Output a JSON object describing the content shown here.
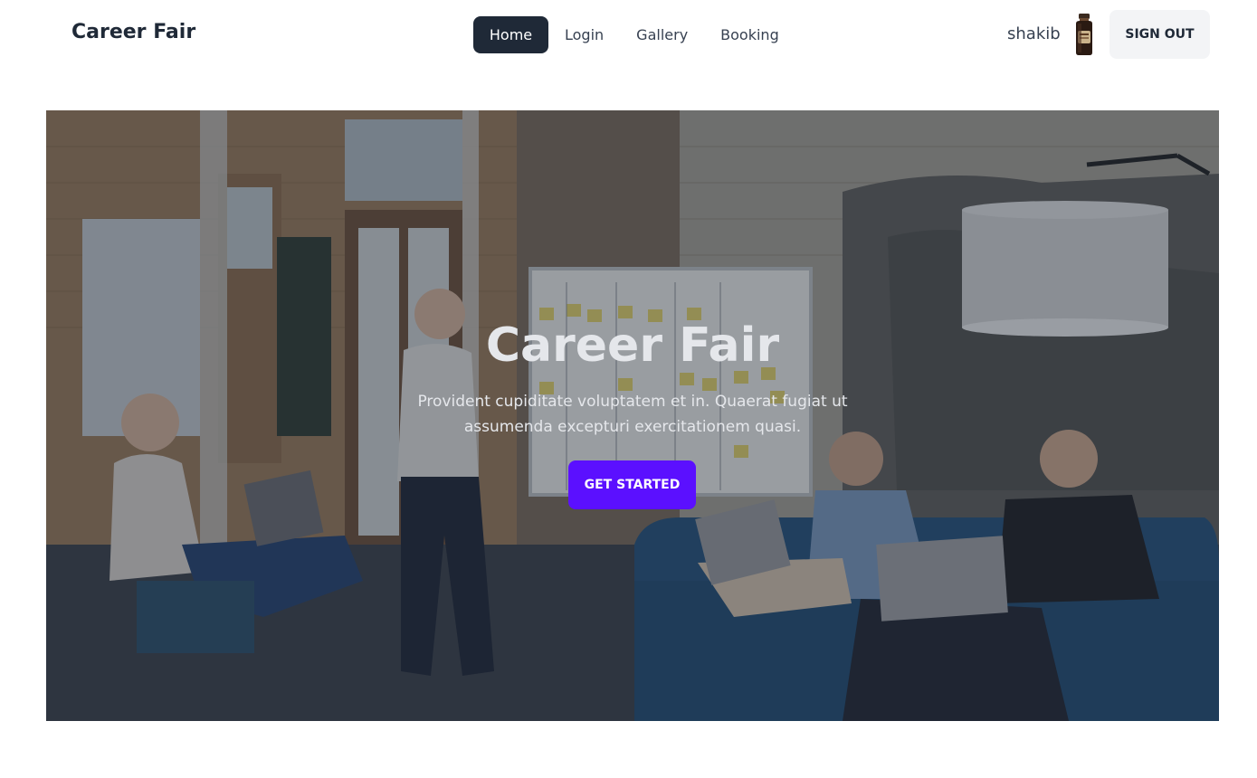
{
  "navbar": {
    "brand": "Career Fair",
    "links": [
      {
        "label": "Home",
        "active": true
      },
      {
        "label": "Login",
        "active": false
      },
      {
        "label": "Gallery",
        "active": false
      },
      {
        "label": "Booking",
        "active": false
      }
    ],
    "user_name": "shakib",
    "avatar_icon": "user-avatar-icon",
    "signout_label": "SIGN OUT"
  },
  "hero": {
    "title": "Career Fair",
    "text": "Provident cupiditate voluptatem et in. Quaerat fugiat ut assumenda excepturi exercitationem quasi.",
    "cta_label": "GET STARTED",
    "background_icon": "office-team-meeting-photo"
  },
  "colors": {
    "active_nav_bg": "#1f2937",
    "cta_bg": "#5b10ff",
    "signout_bg": "#f3f4f6",
    "text_dark": "#1f2937"
  }
}
